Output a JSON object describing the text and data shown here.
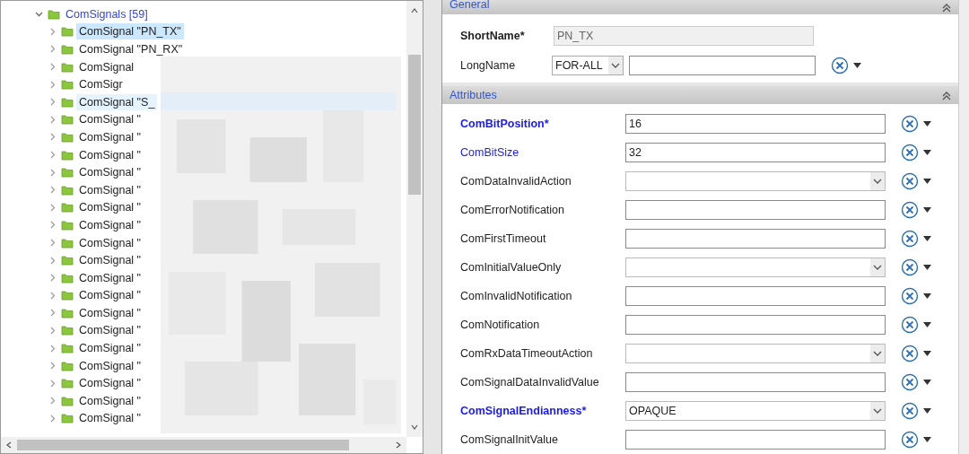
{
  "tree": {
    "label": "ComSignals [59]",
    "expanded": true,
    "children": [
      {
        "label": "ComSignal \"PN_TX\"",
        "selected": true,
        "hover": false
      },
      {
        "label": "ComSignal \"PN_RX\"",
        "selected": false,
        "hover": false
      },
      {
        "label": "ComSignal",
        "selected": false,
        "hover": false
      },
      {
        "label": "ComSigr",
        "selected": false,
        "hover": false
      },
      {
        "label": "ComSignal \"S_",
        "selected": false,
        "hover": true
      },
      {
        "label": "ComSignal \"",
        "selected": false,
        "hover": false
      },
      {
        "label": "ComSignal \"",
        "selected": false,
        "hover": false
      },
      {
        "label": "ComSignal \"",
        "selected": false,
        "hover": false
      },
      {
        "label": "ComSignal \"",
        "selected": false,
        "hover": false
      },
      {
        "label": "ComSignal \"",
        "selected": false,
        "hover": false
      },
      {
        "label": "ComSignal \"",
        "selected": false,
        "hover": false
      },
      {
        "label": "ComSignal \"",
        "selected": false,
        "hover": false
      },
      {
        "label": "ComSignal \"",
        "selected": false,
        "hover": false
      },
      {
        "label": "ComSignal \"",
        "selected": false,
        "hover": false
      },
      {
        "label": "ComSignal \"",
        "selected": false,
        "hover": false
      },
      {
        "label": "ComSignal \"",
        "selected": false,
        "hover": false
      },
      {
        "label": "ComSignal \"",
        "selected": false,
        "hover": false
      },
      {
        "label": "ComSignal \"",
        "selected": false,
        "hover": false
      },
      {
        "label": "ComSignal \"",
        "selected": false,
        "hover": false
      },
      {
        "label": "ComSignal \"",
        "selected": false,
        "hover": false
      },
      {
        "label": "ComSignal \"",
        "selected": false,
        "hover": false
      },
      {
        "label": "ComSignal \"",
        "selected": false,
        "hover": false
      },
      {
        "label": "ComSignal \"",
        "selected": false,
        "hover": false
      }
    ]
  },
  "general": {
    "title": "General",
    "short_name": {
      "label": "ShortName*",
      "value": "PN_TX",
      "disabled": true
    },
    "long_name": {
      "label": "LongName",
      "language": "FOR-ALL"
    }
  },
  "attributes": {
    "title": "Attributes",
    "rows": [
      {
        "label": "ComBitPosition*",
        "required": true,
        "configured": true,
        "kind": "text",
        "value": "16"
      },
      {
        "label": "ComBitSize",
        "required": false,
        "configured": true,
        "kind": "text",
        "value": "32"
      },
      {
        "label": "ComDataInvalidAction",
        "required": false,
        "configured": false,
        "kind": "select"
      },
      {
        "label": "ComErrorNotification",
        "required": false,
        "configured": false,
        "kind": "text"
      },
      {
        "label": "ComFirstTimeout",
        "required": false,
        "configured": false,
        "kind": "text"
      },
      {
        "label": "ComInitialValueOnly",
        "required": false,
        "configured": false,
        "kind": "select"
      },
      {
        "label": "ComInvalidNotification",
        "required": false,
        "configured": false,
        "kind": "text"
      },
      {
        "label": "ComNotification",
        "required": false,
        "configured": false,
        "kind": "text"
      },
      {
        "label": "ComRxDataTimeoutAction",
        "required": false,
        "configured": false,
        "kind": "select"
      },
      {
        "label": "ComSignalDataInvalidValue",
        "required": false,
        "configured": false,
        "kind": "text"
      },
      {
        "label": "ComSignalEndianness*",
        "required": true,
        "configured": true,
        "kind": "select",
        "value": "OPAQUE"
      },
      {
        "label": "ComSignalInitValue",
        "required": false,
        "configured": false,
        "kind": "text"
      }
    ]
  }
}
